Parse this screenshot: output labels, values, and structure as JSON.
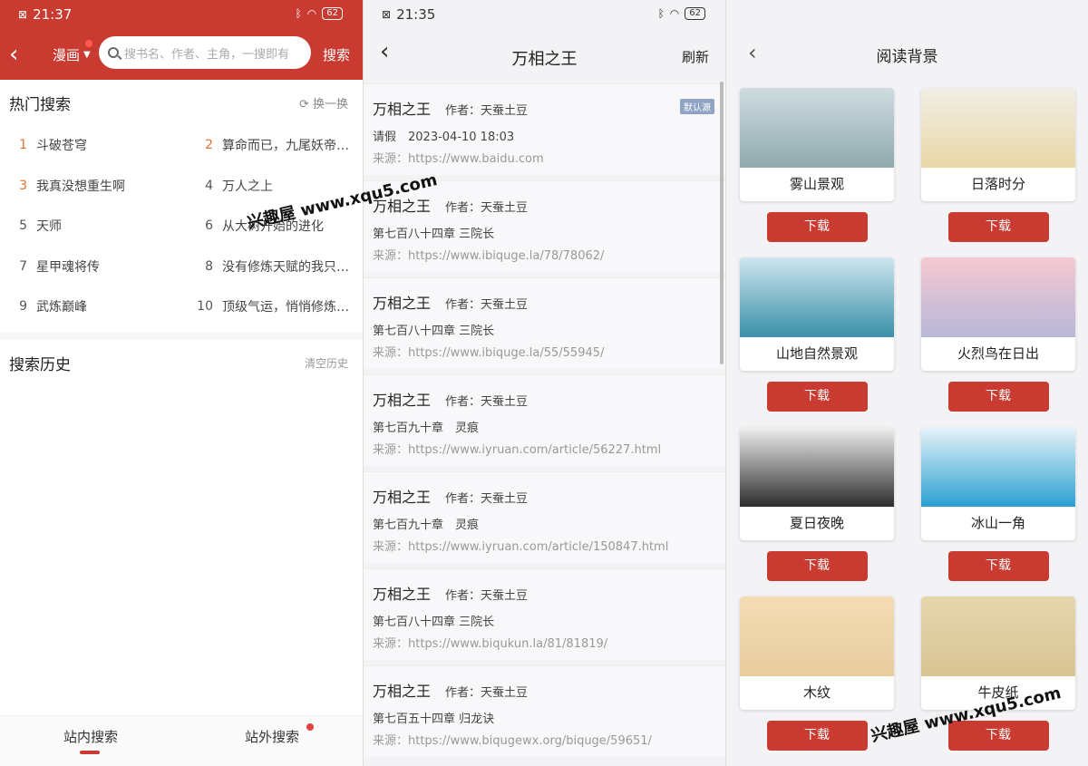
{
  "search_screen": {
    "status": {
      "time": "21:37",
      "battery": "62"
    },
    "category": "漫画",
    "search_placeholder": "搜书名、作者、主角，一搜即有",
    "search_button": "搜索",
    "hot_title": "热门搜索",
    "hot_refresh": "换一换",
    "hot_items": [
      {
        "rank": "1",
        "title": "斗破苍穹"
      },
      {
        "rank": "2",
        "title": "算命而已，九尾妖帝怎么就成我娘子了"
      },
      {
        "rank": "3",
        "title": "我真没想重生啊"
      },
      {
        "rank": "4",
        "title": "万人之上"
      },
      {
        "rank": "5",
        "title": "天师"
      },
      {
        "rank": "6",
        "title": "从大树开始的进化"
      },
      {
        "rank": "7",
        "title": "星甲魂将传"
      },
      {
        "rank": "8",
        "title": "没有修炼天赋的我只能苟着"
      },
      {
        "rank": "9",
        "title": "武炼巅峰"
      },
      {
        "rank": "10",
        "title": "顶级气运，悄悄修炼千年"
      }
    ],
    "history_title": "搜索历史",
    "clear_history": "清空历史",
    "tabs": [
      "站内搜索",
      "站外搜索"
    ]
  },
  "source_screen": {
    "status": {
      "time": "21:35",
      "battery": "62"
    },
    "title": "万相之王",
    "refresh": "刷新",
    "default_badge": "默认源",
    "sources": [
      {
        "book": "万相之王",
        "author": "作者：天蚕土豆",
        "chapter": "请假　2023-04-10 18:03",
        "source": "来源：https://www.baidu.com"
      },
      {
        "book": "万相之王",
        "author": "作者：天蚕土豆",
        "chapter": "第七百八十四章 三院长",
        "source": "来源：https://www.ibiquge.la/78/78062/"
      },
      {
        "book": "万相之王",
        "author": "作者：天蚕土豆",
        "chapter": "第七百八十四章 三院长",
        "source": "来源：https://www.ibiquge.la/55/55945/"
      },
      {
        "book": "万相之王",
        "author": "作者：天蚕土豆",
        "chapter": "第七百九十章　灵痕",
        "source": "来源：https://www.iyruan.com/article/56227.html"
      },
      {
        "book": "万相之王",
        "author": "作者：天蚕土豆",
        "chapter": "第七百九十章　灵痕",
        "source": "来源：https://www.iyruan.com/article/150847.html"
      },
      {
        "book": "万相之王",
        "author": "作者：天蚕土豆",
        "chapter": "第七百八十四章 三院长",
        "source": "来源：https://www.biqukun.la/81/81819/"
      },
      {
        "book": "万相之王",
        "author": "作者：天蚕土豆",
        "chapter": "第七百五十四章 归龙诀",
        "source": "来源：https://www.biqugewx.org/biquge/59651/"
      }
    ]
  },
  "background_screen": {
    "title": "阅读背景",
    "download_label": "下载",
    "backgrounds": [
      {
        "name": "雾山景观",
        "c1": "#cfdce0",
        "c2": "#8fa9ad"
      },
      {
        "name": "日落时分",
        "c1": "#f2eee6",
        "c2": "#e8d7a8"
      },
      {
        "name": "山地自然景观",
        "c1": "#cfe6f0",
        "c2": "#3a90a8"
      },
      {
        "name": "火烈鸟在日出",
        "c1": "#f6c9d2",
        "c2": "#b8b7d8"
      },
      {
        "name": "夏日夜晚",
        "c1": "#f0f0f0",
        "c2": "#2d2d2d"
      },
      {
        "name": "冰山一角",
        "c1": "#e8f4fa",
        "c2": "#2aa0d0"
      },
      {
        "name": "木纹",
        "c1": "#f3dcb5",
        "c2": "#e8cc9e"
      },
      {
        "name": "牛皮纸",
        "c1": "#e6d6ae",
        "c2": "#d8c594"
      }
    ]
  },
  "watermark": "兴趣屋 www.xqu5.com"
}
